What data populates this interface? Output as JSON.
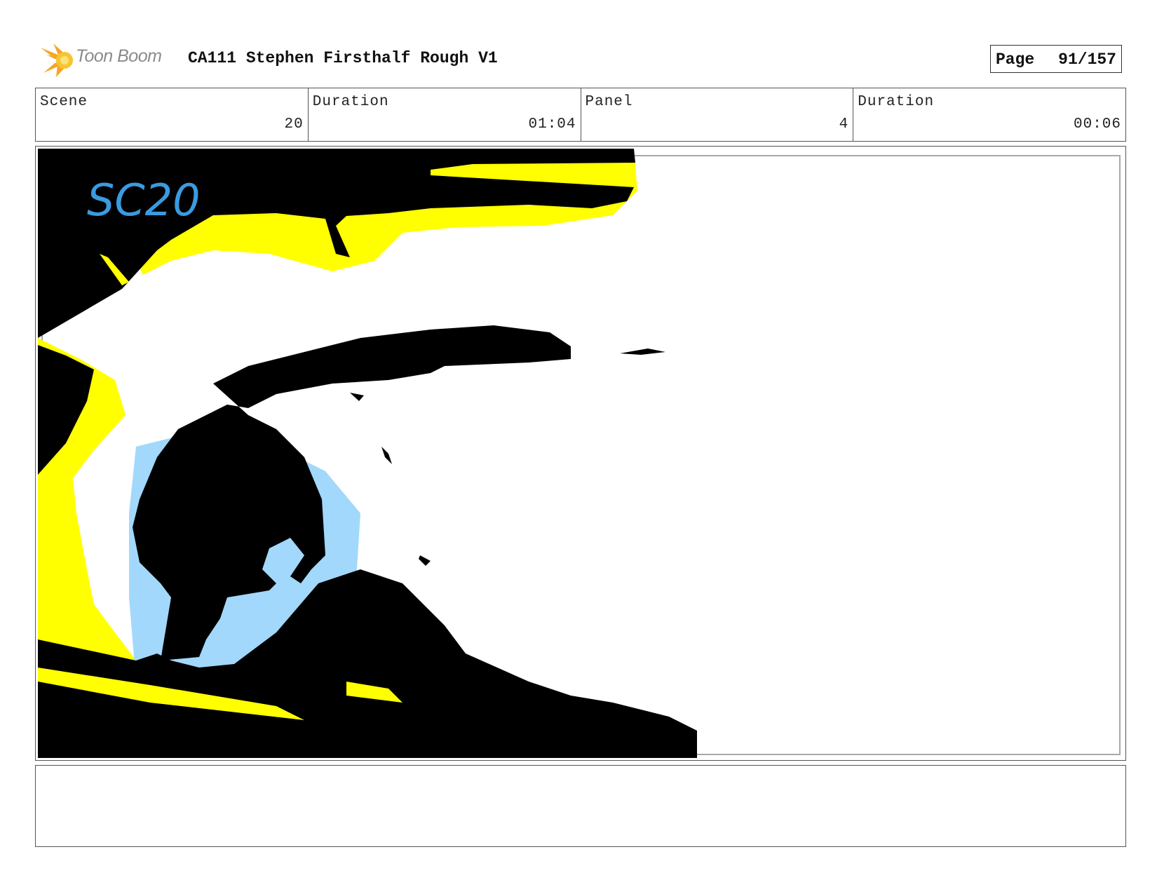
{
  "header": {
    "logo_text": "Toon Boom",
    "title": "CA111 Stephen Firsthalf Rough V1",
    "page_label": "Page",
    "page_number": "91/157"
  },
  "info": {
    "scene_label": "Scene",
    "scene_value": "20",
    "scene_duration_label": "Duration",
    "scene_duration_value": "01:04",
    "panel_label": "Panel",
    "panel_value": "4",
    "panel_duration_label": "Duration",
    "panel_duration_value": "00:06"
  },
  "panel": {
    "sketch_label": "SC20",
    "colors": {
      "ink": "#000000",
      "yellow": "#ffff00",
      "light_blue": "#a2d8fb",
      "label_blue": "#3a9be0"
    }
  },
  "colors": {
    "border": "#555555",
    "safe_frame": "#a8a8a8",
    "logo_orange": "#f5a623",
    "logo_text": "#8a8a8a"
  }
}
